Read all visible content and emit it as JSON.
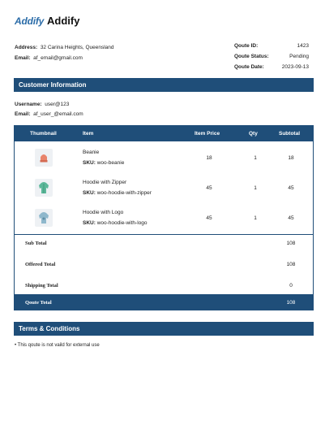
{
  "header": {
    "logo": "Addify",
    "brand": "Addify"
  },
  "customer_address": {
    "address_label": "Address:",
    "address": "32 Carina Heights, Queensland",
    "email_label": "Email:",
    "email": "af_email@gmail.com"
  },
  "quote": [
    {
      "label": "Qoute ID:",
      "value": "1423"
    },
    {
      "label": "Qoute Status:",
      "value": "Pending"
    },
    {
      "label": "Qoute Date:",
      "value": "2023-09-13"
    }
  ],
  "customer_info": {
    "title": "Customer Information",
    "username_label": "Username:",
    "username": "user@123",
    "email_label": "Email:",
    "email": "af_user_@email.com"
  },
  "table": {
    "headers": [
      "Thumbnail",
      "Item",
      "Item Price",
      "Qty",
      "Subtotal"
    ],
    "rows": [
      {
        "name": "Beanie",
        "sku_label": "SKU:",
        "sku": "woo-beanie",
        "price": "18",
        "qty": "1",
        "subtotal": "18",
        "thumb_icon": "beanie-icon",
        "color": "#e8836b"
      },
      {
        "name": "Hoodie with Zipper",
        "sku_label": "SKU:",
        "sku": "woo-hoodie-with-zipper",
        "price": "45",
        "qty": "1",
        "subtotal": "45",
        "thumb_icon": "hoodie-zipper-icon",
        "color": "#5cb89a"
      },
      {
        "name": "Hoodie with Logo",
        "sku_label": "SKU:",
        "sku": "woo-hoodie-with-logo",
        "price": "45",
        "qty": "1",
        "subtotal": "45",
        "thumb_icon": "hoodie-logo-icon",
        "color": "#8fb8cc"
      }
    ],
    "totals": [
      {
        "label": "Sub Total",
        "value": "108"
      },
      {
        "label": "Offered Total",
        "value": "108"
      },
      {
        "label": "Shipping Total",
        "value": "0"
      }
    ],
    "grand": {
      "label": "Qoute Total",
      "value": "108"
    }
  },
  "terms": {
    "title": "Terms & Conditions",
    "items": [
      "This qoute is not vaild for external use"
    ]
  },
  "colors": {
    "accent": "#1f4e79",
    "logo": "#2b6ca8"
  }
}
